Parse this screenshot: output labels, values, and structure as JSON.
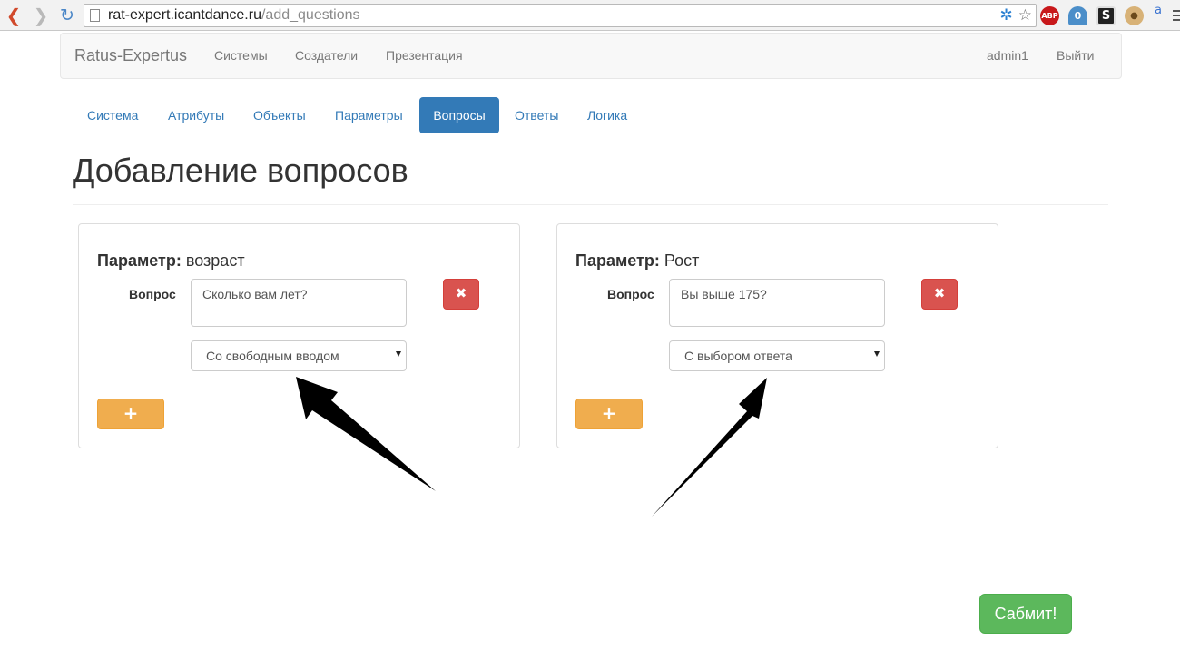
{
  "browser": {
    "url_host": "rat-expert.icantdance.ru",
    "url_path": "/add_questions",
    "ext_abp": "ABP",
    "ext_ghost_badge": "0",
    "ext_s": "S",
    "ext_a": "a"
  },
  "navbar": {
    "brand": "Ratus-Expertus",
    "links": [
      "Системы",
      "Создатели",
      "Презентация"
    ],
    "user": "admin1",
    "logout": "Выйти"
  },
  "tabs": [
    {
      "label": "Система",
      "active": false
    },
    {
      "label": "Атрибуты",
      "active": false
    },
    {
      "label": "Объекты",
      "active": false
    },
    {
      "label": "Параметры",
      "active": false
    },
    {
      "label": "Вопросы",
      "active": true
    },
    {
      "label": "Ответы",
      "active": false
    },
    {
      "label": "Логика",
      "active": false
    }
  ],
  "page_title": "Добавление вопросов",
  "cards": [
    {
      "param_label": "Параметр:",
      "param_value": "возраст",
      "question_label": "Вопрос",
      "question_value": "Сколько вам лет?",
      "type_selected": "Со свободным вводом",
      "delete_glyph": "✖",
      "add_glyph": "+"
    },
    {
      "param_label": "Параметр:",
      "param_value": "Рост",
      "question_label": "Вопрос",
      "question_value": "Вы выше 175?",
      "type_selected": "С выбором ответа",
      "delete_glyph": "✖",
      "add_glyph": "+"
    }
  ],
  "submit_label": "Сабмит!",
  "colors": {
    "primary": "#337ab7",
    "danger": "#d9534f",
    "warning": "#f0ad4e",
    "success": "#5cb85c"
  },
  "icons": [
    "back-arrow-icon",
    "forward-arrow-icon",
    "reload-icon",
    "page-icon",
    "extension-icon",
    "star-icon",
    "menu-icon"
  ]
}
